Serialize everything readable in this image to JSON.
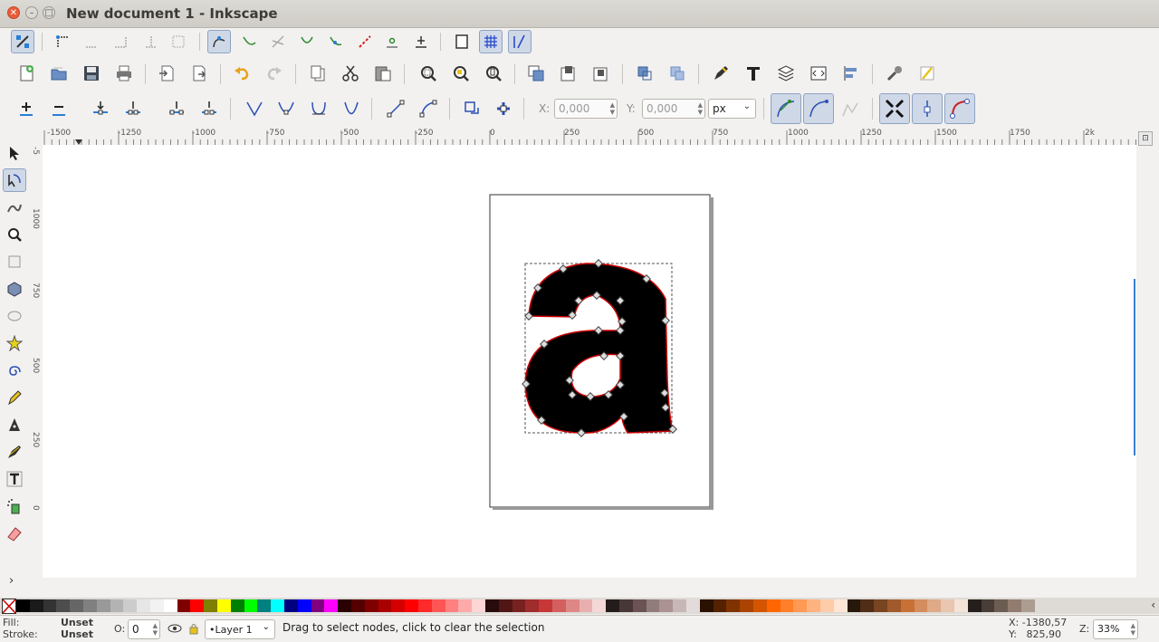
{
  "window": {
    "title": "New document 1 - Inkscape"
  },
  "toolbar_tool_options": {
    "x_label": "X:",
    "x_value": "0,000",
    "y_label": "Y:",
    "y_value": "0,000",
    "unit": "px"
  },
  "ruler_h": [
    "-1500",
    "-1250",
    "-1000",
    "-750",
    "-500",
    "-250",
    "0",
    "250",
    "500",
    "750",
    "1000",
    "1250",
    "1500",
    "1750",
    "2k"
  ],
  "ruler_v": [
    "-5",
    "1000",
    "750",
    "500",
    "250",
    "0"
  ],
  "status": {
    "fill_label": "Fill:",
    "fill_value": "Unset",
    "stroke_label": "Stroke:",
    "stroke_value": "Unset",
    "opacity_label": "O:",
    "opacity_value": "0",
    "layer": "•Layer 1",
    "message": "Drag to select nodes, click to clear the selection",
    "x_coord": "X: -1380,57",
    "y_coord": "Y:   825,90",
    "zoom_label": "Z:",
    "zoom_value": "33%"
  },
  "colors": {
    "accent": "#8ea3c3",
    "selection_stroke": "#cc0000",
    "palette": [
      "#000000",
      "#1a1a1a",
      "#333333",
      "#4d4d4d",
      "#666666",
      "#808080",
      "#999999",
      "#b3b3b3",
      "#cccccc",
      "#e6e6e6",
      "#f2f2f2",
      "#ffffff",
      "#800000",
      "#ff0000",
      "#808000",
      "#ffff00",
      "#008000",
      "#00ff00",
      "#008080",
      "#00ffff",
      "#000080",
      "#0000ff",
      "#800080",
      "#ff00ff",
      "#2b0000",
      "#550000",
      "#800000",
      "#aa0000",
      "#d40000",
      "#ff0000",
      "#ff2a2a",
      "#ff5555",
      "#ff8080",
      "#ffaaaa",
      "#ffd5d5",
      "#280b0b",
      "#501616",
      "#782121",
      "#a02c2c",
      "#c83737",
      "#d35f5f",
      "#de8787",
      "#e9afaf",
      "#f4d7d7",
      "#241c1c",
      "#483737",
      "#6c5353",
      "#917c7c",
      "#ac9393",
      "#c8b7b7",
      "#e3dbdb",
      "#2b1100",
      "#552200",
      "#803300",
      "#aa4400",
      "#d45500",
      "#ff6600",
      "#ff7f2a",
      "#ff9955",
      "#ffb380",
      "#ffccaa",
      "#ffe6d5",
      "#28170b",
      "#502d16",
      "#784421",
      "#a05a2c",
      "#c87137",
      "#d38d5f",
      "#deaa87",
      "#e9c6af",
      "#f4e3d7",
      "#241f1c",
      "#483e37",
      "#6c5d53",
      "#917c6f",
      "#ac9d93"
    ]
  }
}
